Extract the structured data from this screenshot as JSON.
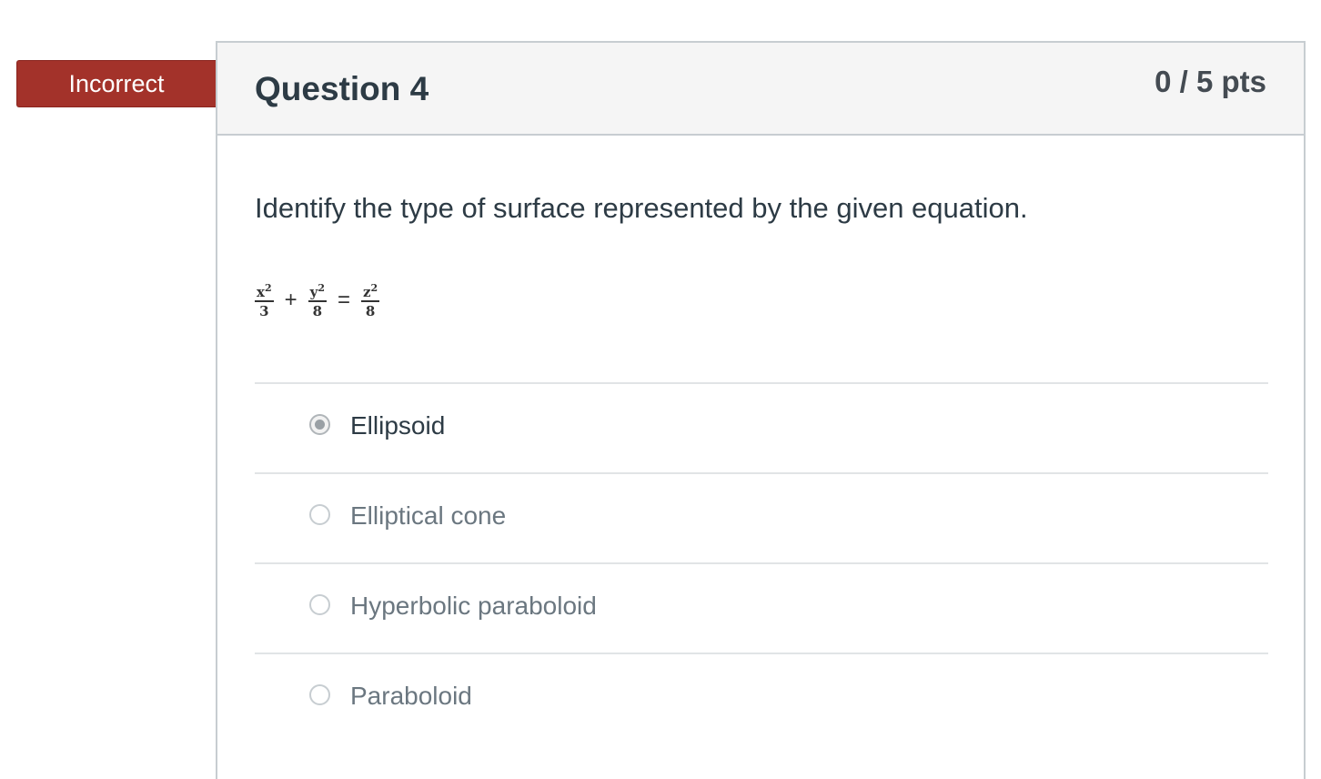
{
  "status_flag": "Incorrect",
  "question": {
    "title": "Question 4",
    "points": "0 / 5 pts",
    "prompt": "Identify the type of surface represented by the given equation.",
    "equation": {
      "term1_num": "x2",
      "term1_den": "3",
      "plus": "+",
      "term2_num": "y2",
      "term2_den": "8",
      "equals": "=",
      "term3_num": "z2",
      "term3_den": "8"
    },
    "answers": [
      {
        "label": "Ellipsoid",
        "selected": true
      },
      {
        "label": "Elliptical cone",
        "selected": false
      },
      {
        "label": "Hyperbolic paraboloid",
        "selected": false
      },
      {
        "label": "Paraboloid",
        "selected": false
      }
    ]
  },
  "colors": {
    "flag_red": "#a3322a",
    "text_dark": "#2d3b45",
    "text_muted": "#6b7780",
    "border": "#c7cdd1",
    "header_bg": "#f5f5f5"
  }
}
